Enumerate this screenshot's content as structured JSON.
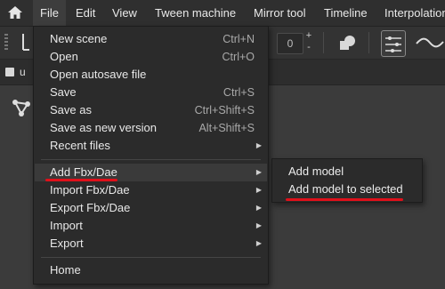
{
  "menubar": {
    "items": [
      {
        "label": "File"
      },
      {
        "label": "Edit"
      },
      {
        "label": "View"
      },
      {
        "label": "Tween machine"
      },
      {
        "label": "Mirror tool"
      },
      {
        "label": "Timeline"
      },
      {
        "label": "Interpolation"
      }
    ]
  },
  "toolbar": {
    "number_value": "0",
    "stepper_plus": "+",
    "stepper_minus": "-"
  },
  "tab": {
    "label": "u"
  },
  "file_menu": {
    "items": [
      {
        "label": "New scene",
        "shortcut": "Ctrl+N"
      },
      {
        "label": "Open",
        "shortcut": "Ctrl+O"
      },
      {
        "label": "Open autosave file",
        "shortcut": ""
      },
      {
        "label": "Save",
        "shortcut": "Ctrl+S"
      },
      {
        "label": "Save as",
        "shortcut": "Ctrl+Shift+S"
      },
      {
        "label": "Save as new version",
        "shortcut": "Alt+Shift+S"
      },
      {
        "label": "Recent files",
        "shortcut": ""
      },
      {
        "label": "Add Fbx/Dae",
        "shortcut": ""
      },
      {
        "label": "Import Fbx/Dae",
        "shortcut": ""
      },
      {
        "label": "Export Fbx/Dae",
        "shortcut": ""
      },
      {
        "label": "Import",
        "shortcut": ""
      },
      {
        "label": "Export",
        "shortcut": ""
      },
      {
        "label": "Home",
        "shortcut": ""
      }
    ]
  },
  "submenu": {
    "items": [
      {
        "label": "Add model"
      },
      {
        "label": "Add model to selected"
      }
    ]
  },
  "colors": {
    "accent_underline": "#e0101a",
    "menu_bg": "#2b2b2b",
    "app_bg": "#3a3a3a"
  }
}
